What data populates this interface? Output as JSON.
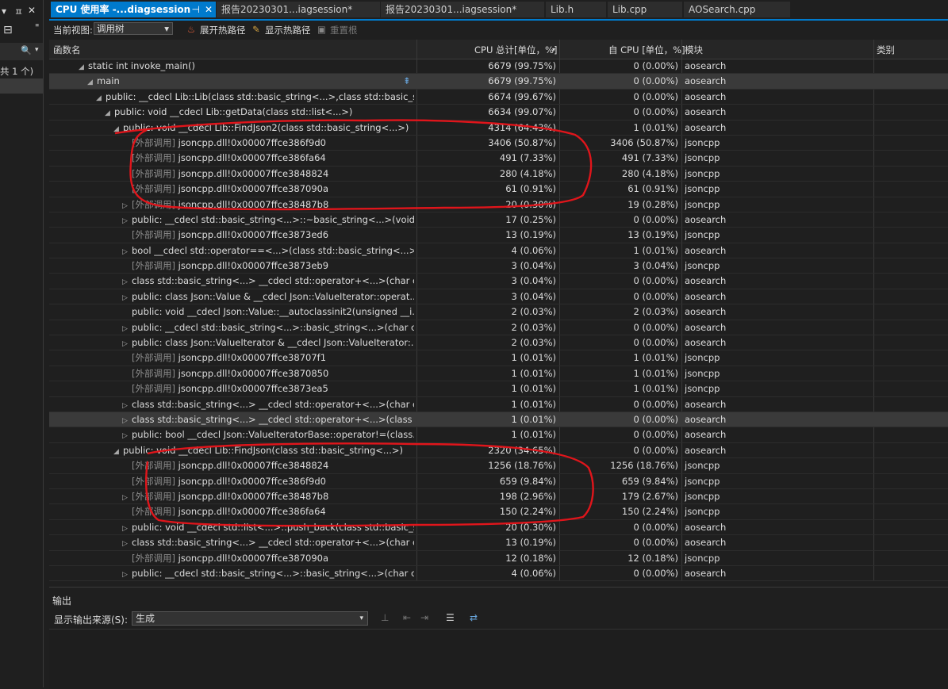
{
  "left": {
    "ctl_a": "▾",
    "ctl_b": "ㅍ",
    "ctl_c": "✕",
    "ctl_d": "⊟",
    "ctl_e": "\"",
    "search_icon": "🔍",
    "search_chev": "▾",
    "count_text": "共 1 个)"
  },
  "tabs": [
    {
      "label": "CPU 使用率 -...diagsession",
      "pin": "⊣",
      "close": "✕"
    },
    {
      "label": "报告20230301...iagsession*"
    },
    {
      "label": "报告20230301...iagsession*"
    },
    {
      "label": "Lib.h"
    },
    {
      "label": "Lib.cpp"
    },
    {
      "label": "AOSearch.cpp"
    }
  ],
  "toolbar": {
    "view_label": "当前视图:",
    "view_value": "调用树",
    "expand_hot": "展开热路径",
    "show_hot": "显示热路径",
    "reset": "重置根"
  },
  "columns": {
    "name": "函数名",
    "total": "CPU 总计[单位，%]",
    "self": "自 CPU [单位，%]",
    "module": "模块",
    "category": "类别",
    "sort_icon": "▾"
  },
  "rows": [
    {
      "indent": 3,
      "tri": "◢",
      "name": "static int invoke_main()",
      "total": "6679 (99.75%)",
      "self": "0 (0.00%)",
      "module": "aosearch"
    },
    {
      "indent": 4,
      "tri": "◢",
      "name": "main",
      "total": "6679 (99.75%)",
      "self": "0 (0.00%)",
      "module": "aosearch",
      "sel": true,
      "flag": "⇞"
    },
    {
      "indent": 5,
      "tri": "◢",
      "name": "public: __cdecl Lib::Lib(class std::basic_string<...>,class std::basic_str...",
      "total": "6674 (99.67%)",
      "self": "0 (0.00%)",
      "module": "aosearch"
    },
    {
      "indent": 6,
      "tri": "◢",
      "name": "public: void __cdecl Lib::getData(class std::list<...>)",
      "total": "6634 (99.07%)",
      "self": "0 (0.00%)",
      "module": "aosearch"
    },
    {
      "indent": 7,
      "tri": "◢",
      "name": "public: void __cdecl Lib::FindJson2(class std::basic_string<...>)",
      "total": "4314 (64.43%)",
      "self": "1 (0.01%)",
      "module": "aosearch"
    },
    {
      "indent": 8,
      "tri": "",
      "ext": "[外部调用]",
      "name": "jsoncpp.dll!0x00007ffce386f9d0",
      "total": "3406 (50.87%)",
      "self": "3406 (50.87%)",
      "module": "jsoncpp"
    },
    {
      "indent": 8,
      "tri": "",
      "ext": "[外部调用]",
      "name": "jsoncpp.dll!0x00007ffce386fa64",
      "total": "491 (7.33%)",
      "self": "491 (7.33%)",
      "module": "jsoncpp"
    },
    {
      "indent": 8,
      "tri": "",
      "ext": "[外部调用]",
      "name": "jsoncpp.dll!0x00007ffce3848824",
      "total": "280 (4.18%)",
      "self": "280 (4.18%)",
      "module": "jsoncpp"
    },
    {
      "indent": 8,
      "tri": "",
      "ext": "[外部调用]",
      "name": "jsoncpp.dll!0x00007ffce387090a",
      "total": "61 (0.91%)",
      "self": "61 (0.91%)",
      "module": "jsoncpp"
    },
    {
      "indent": 8,
      "tri": "▷",
      "ext": "[外部调用]",
      "name": "jsoncpp.dll!0x00007ffce38487b8",
      "total": "20 (0.30%)",
      "self": "19 (0.28%)",
      "module": "jsoncpp"
    },
    {
      "indent": 8,
      "tri": "▷",
      "name": "public: __cdecl std::basic_string<...>::~basic_string<...>(void)",
      "total": "17 (0.25%)",
      "self": "0 (0.00%)",
      "module": "aosearch"
    },
    {
      "indent": 8,
      "tri": "",
      "ext": "[外部调用]",
      "name": "jsoncpp.dll!0x00007ffce3873ed6",
      "total": "13 (0.19%)",
      "self": "13 (0.19%)",
      "module": "jsoncpp"
    },
    {
      "indent": 8,
      "tri": "▷",
      "name": "bool __cdecl std::operator==<...>(class std::basic_string<...> ...",
      "total": "4 (0.06%)",
      "self": "1 (0.01%)",
      "module": "aosearch"
    },
    {
      "indent": 8,
      "tri": "",
      "ext": "[外部调用]",
      "name": "jsoncpp.dll!0x00007ffce3873eb9",
      "total": "3 (0.04%)",
      "self": "3 (0.04%)",
      "module": "jsoncpp"
    },
    {
      "indent": 8,
      "tri": "▷",
      "name": "class std::basic_string<...> __cdecl std::operator+<...>(char c...",
      "total": "3 (0.04%)",
      "self": "0 (0.00%)",
      "module": "aosearch"
    },
    {
      "indent": 8,
      "tri": "▷",
      "name": "public: class Json::Value & __cdecl Json::ValueIterator::operat...",
      "total": "3 (0.04%)",
      "self": "0 (0.00%)",
      "module": "aosearch"
    },
    {
      "indent": 8,
      "tri": "",
      "name": "public: void __cdecl Json::Value::__autoclassinit2(unsigned __i...",
      "total": "2 (0.03%)",
      "self": "2 (0.03%)",
      "module": "aosearch"
    },
    {
      "indent": 8,
      "tri": "▷",
      "name": "public: __cdecl std::basic_string<...>::basic_string<...>(char co...",
      "total": "2 (0.03%)",
      "self": "0 (0.00%)",
      "module": "aosearch"
    },
    {
      "indent": 8,
      "tri": "▷",
      "name": "public: class Json::ValueIterator & __cdecl Json::ValueIterator:...",
      "total": "2 (0.03%)",
      "self": "0 (0.00%)",
      "module": "aosearch"
    },
    {
      "indent": 8,
      "tri": "",
      "ext": "[外部调用]",
      "name": "jsoncpp.dll!0x00007ffce38707f1",
      "total": "1 (0.01%)",
      "self": "1 (0.01%)",
      "module": "jsoncpp"
    },
    {
      "indent": 8,
      "tri": "",
      "ext": "[外部调用]",
      "name": "jsoncpp.dll!0x00007ffce3870850",
      "total": "1 (0.01%)",
      "self": "1 (0.01%)",
      "module": "jsoncpp"
    },
    {
      "indent": 8,
      "tri": "",
      "ext": "[外部调用]",
      "name": "jsoncpp.dll!0x00007ffce3873ea5",
      "total": "1 (0.01%)",
      "self": "1 (0.01%)",
      "module": "jsoncpp"
    },
    {
      "indent": 8,
      "tri": "▷",
      "name": "class std::basic_string<...> __cdecl std::operator+<...>(char c...",
      "total": "1 (0.01%)",
      "self": "0 (0.00%)",
      "module": "aosearch"
    },
    {
      "indent": 8,
      "tri": "▷",
      "name": "class std::basic_string<...> __cdecl std::operator+<...>(class st...",
      "total": "1 (0.01%)",
      "self": "0 (0.00%)",
      "module": "aosearch",
      "sel": true
    },
    {
      "indent": 8,
      "tri": "▷",
      "name": "public: bool __cdecl Json::ValueIteratorBase::operator!=(class...",
      "total": "1 (0.01%)",
      "self": "0 (0.00%)",
      "module": "aosearch"
    },
    {
      "indent": 7,
      "tri": "◢",
      "name": "public: void __cdecl Lib::FindJson(class std::basic_string<...>)",
      "total": "2320 (34.65%)",
      "self": "0 (0.00%)",
      "module": "aosearch"
    },
    {
      "indent": 8,
      "tri": "",
      "ext": "[外部调用]",
      "name": "jsoncpp.dll!0x00007ffce3848824",
      "total": "1256 (18.76%)",
      "self": "1256 (18.76%)",
      "module": "jsoncpp"
    },
    {
      "indent": 8,
      "tri": "",
      "ext": "[外部调用]",
      "name": "jsoncpp.dll!0x00007ffce386f9d0",
      "total": "659 (9.84%)",
      "self": "659 (9.84%)",
      "module": "jsoncpp"
    },
    {
      "indent": 8,
      "tri": "▷",
      "ext": "[外部调用]",
      "name": "jsoncpp.dll!0x00007ffce38487b8",
      "total": "198 (2.96%)",
      "self": "179 (2.67%)",
      "module": "jsoncpp"
    },
    {
      "indent": 8,
      "tri": "",
      "ext": "[外部调用]",
      "name": "jsoncpp.dll!0x00007ffce386fa64",
      "total": "150 (2.24%)",
      "self": "150 (2.24%)",
      "module": "jsoncpp"
    },
    {
      "indent": 8,
      "tri": "▷",
      "name": "public: void __cdecl std::list<...>::push_back(class std::basic_st...",
      "total": "20 (0.30%)",
      "self": "0 (0.00%)",
      "module": "aosearch"
    },
    {
      "indent": 8,
      "tri": "▷",
      "name": "class std::basic_string<...> __cdecl std::operator+<...>(char c...",
      "total": "13 (0.19%)",
      "self": "0 (0.00%)",
      "module": "aosearch"
    },
    {
      "indent": 8,
      "tri": "",
      "ext": "[外部调用]",
      "name": "jsoncpp.dll!0x00007ffce387090a",
      "total": "12 (0.18%)",
      "self": "12 (0.18%)",
      "module": "jsoncpp"
    },
    {
      "indent": 8,
      "tri": "▷",
      "name": "public: __cdecl std::basic_string<...>::basic_string<...>(char co...",
      "total": "4 (0.06%)",
      "self": "0 (0.00%)",
      "module": "aosearch"
    }
  ],
  "output": {
    "title": "输出",
    "source_label": "显示输出来源(S):",
    "source_value": "生成",
    "chev": "▾"
  },
  "colors": {
    "accent": "#007acc",
    "annotation": "#e0151b"
  }
}
